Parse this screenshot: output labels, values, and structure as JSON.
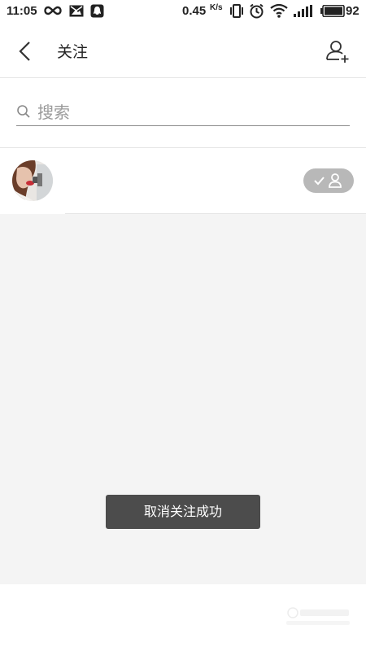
{
  "status_bar": {
    "time": "11:05",
    "net_speed": "0.45",
    "net_speed_unit": "K/s",
    "battery": "92"
  },
  "header": {
    "title": "关注"
  },
  "search": {
    "placeholder": "搜索",
    "value": ""
  },
  "follow_list": {
    "items": [
      {
        "status": "following"
      }
    ]
  },
  "toast": {
    "message": "取消关注成功"
  },
  "colors": {
    "background": "#f4f4f4",
    "toast_bg": "#4c4c4c",
    "badge_bg": "#b8b8b8"
  }
}
